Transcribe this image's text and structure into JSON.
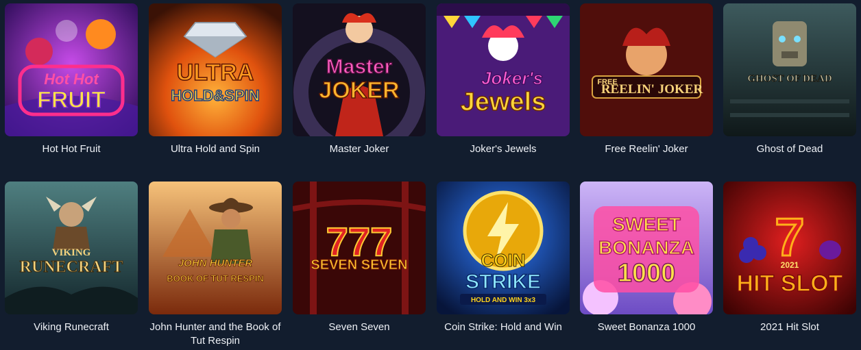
{
  "games": [
    {
      "id": "hot-hot-fruit",
      "title": "Hot Hot Fruit",
      "art": [
        "Hot Hot",
        "FRUIT"
      ],
      "colors": {
        "bg1": "#7a2cc9",
        "bg2": "#2a0b56",
        "accent": "#ff2e8c",
        "text": "#ffe14a"
      }
    },
    {
      "id": "ultra-hold-and-spin",
      "title": "Ultra Hold and Spin",
      "art": [
        "ULTRA",
        "HOLD&SPIN"
      ],
      "colors": {
        "bg1": "#f07a12",
        "bg2": "#3a1206",
        "accent": "#e8eef5",
        "text": "#ffcf3a"
      }
    },
    {
      "id": "master-joker",
      "title": "Master Joker",
      "art": [
        "Master",
        "JOKER"
      ],
      "colors": {
        "bg1": "#2a2240",
        "bg2": "#0d0a18",
        "accent": "#d9301c",
        "text": "#ff5fc1"
      }
    },
    {
      "id": "jokers-jewels",
      "title": "Joker's Jewels",
      "art": [
        "Joker's",
        "Jewels"
      ],
      "colors": {
        "bg1": "#6a2a9c",
        "bg2": "#2b0d4a",
        "accent": "#ff3b5c",
        "text": "#ffd63a"
      }
    },
    {
      "id": "free-reelin-joker",
      "title": "Free Reelin' Joker",
      "art": [
        "FREE",
        "REELIN' JOKER"
      ],
      "colors": {
        "bg1": "#6a120f",
        "bg2": "#240605",
        "accent": "#e94a2e",
        "text": "#f6d27a"
      }
    },
    {
      "id": "ghost-of-dead",
      "title": "Ghost of Dead",
      "art": [
        "GHOST OF DEAD"
      ],
      "colors": {
        "bg1": "#2f4649",
        "bg2": "#0f1819",
        "accent": "#79e0ff",
        "text": "#c9c2a3"
      }
    },
    {
      "id": "viking-runecraft",
      "title": "Viking Runecraft",
      "art": [
        "VIKING",
        "RUNECRAFT"
      ],
      "colors": {
        "bg1": "#3b6366",
        "bg2": "#13262b",
        "accent": "#e2b44a",
        "text": "#f2d27e"
      }
    },
    {
      "id": "john-hunter-tut",
      "title": "John Hunter and the Book of Tut Respin",
      "art": [
        "JOHN HUNTER",
        "BOOK OF TUT RESPIN"
      ],
      "colors": {
        "bg1": "#f0a148",
        "bg2": "#7a2a0c",
        "accent": "#5c3a1d",
        "text": "#ffd13a"
      }
    },
    {
      "id": "seven-seven",
      "title": "Seven Seven",
      "art": [
        "777",
        "SEVEN SEVEN"
      ],
      "colors": {
        "bg1": "#7d1414",
        "bg2": "#2a0505",
        "accent": "#e02323",
        "text": "#ffcc33"
      }
    },
    {
      "id": "coin-strike",
      "title": "Coin Strike: Hold and Win",
      "art": [
        "COIN",
        "STRIKE",
        "HOLD AND WIN 3x3"
      ],
      "colors": {
        "bg1": "#1b4fb0",
        "bg2": "#07153a",
        "accent": "#ffd21a",
        "text": "#8fe9ff"
      }
    },
    {
      "id": "sweet-bonanza-1000",
      "title": "Sweet Bonanza 1000",
      "art": [
        "SWEET",
        "BONANZA",
        "1000"
      ],
      "colors": {
        "bg1": "#b796f2",
        "bg2": "#6d4cc4",
        "accent": "#ff4fa5",
        "text": "#ffe14a"
      }
    },
    {
      "id": "2021-hit-slot",
      "title": "2021 Hit Slot",
      "art": [
        "7",
        "2021",
        "HIT SLOT"
      ],
      "colors": {
        "bg1": "#c41414",
        "bg2": "#3d0303",
        "accent": "#ffb01a",
        "text": "#ffe06a"
      }
    }
  ]
}
